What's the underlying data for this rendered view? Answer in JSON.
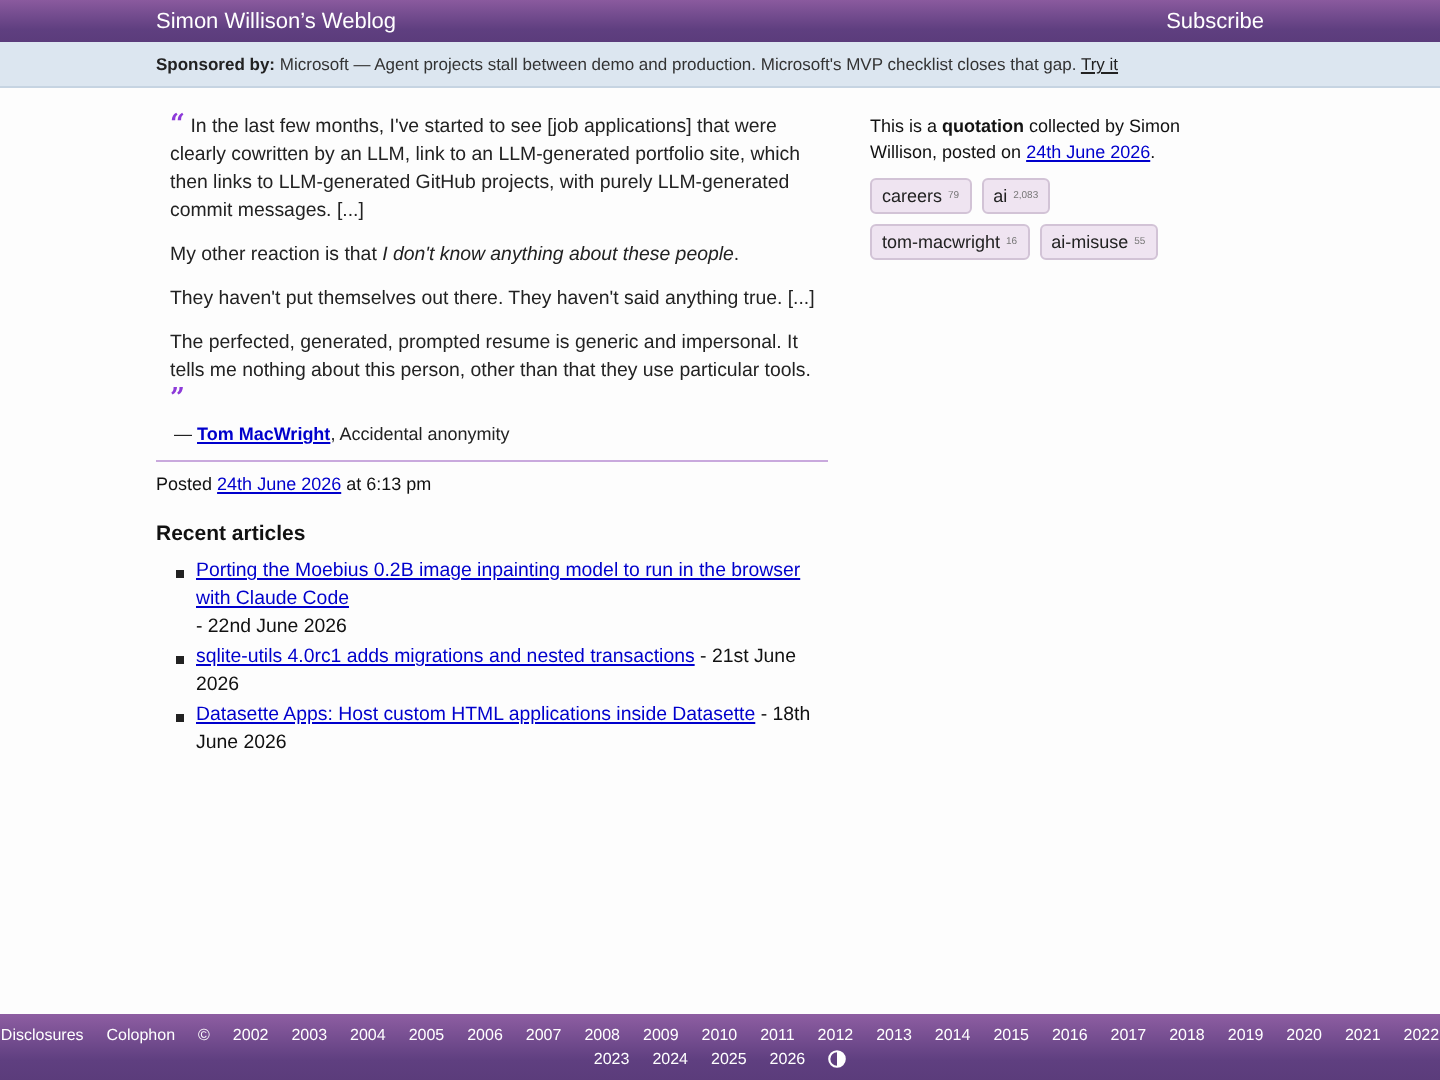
{
  "header": {
    "title": "Simon Willison’s Weblog",
    "subscribe": "Subscribe"
  },
  "sponsor": {
    "label": "Sponsored by:",
    "text": "Microsoft — Agent projects stall between demo and production. Microsoft's MVP checklist closes that gap.",
    "link": "Try it"
  },
  "quote": {
    "open_mark": "“",
    "close_mark": "”",
    "paragraphs": [
      "In the last few months, I've started to see [job applications] that were clearly cowritten by an LLM, link to an LLM-generated portfolio site, which then links to LLM-generated GitHub projects, with purely LLM-generated commit messages. [...]",
      "My other reaction is that *I don't know anything about these people*.",
      "They haven't put themselves out there. They haven't said anything true. [...]",
      "The perfected, generated, prompted resume is generic and impersonal. It tells me nothing about this person, other than that they use particular tools."
    ],
    "dash": "—",
    "author": "Tom MacWright",
    "source": ", Accidental anonymity"
  },
  "posted": {
    "prefix": "Posted",
    "date": "24th June 2026",
    "suffix": "at 6:13 pm"
  },
  "recent": {
    "heading": "Recent articles",
    "items": [
      {
        "title": "Porting the Moebius 0.2B image inpainting model to run in the browser with Claude Code",
        "date": "- 22nd June 2026"
      },
      {
        "title": "sqlite-utils 4.0rc1 adds migrations and nested transactions",
        "date": "- 21st June 2026"
      },
      {
        "title": "Datasette Apps: Host custom HTML applications inside Datasette",
        "date": "- 18th June 2026"
      }
    ]
  },
  "sidebar": {
    "intro": "This is a **quotation** collected by Simon Willison, posted on",
    "date": "24th June 2026",
    "end": ".",
    "tags": [
      {
        "name": "careers",
        "count": "79"
      },
      {
        "name": "ai",
        "count": "2,083"
      },
      {
        "name": "tom-macwright",
        "count": "16"
      },
      {
        "name": "ai-misuse",
        "count": "55"
      }
    ]
  },
  "footer": {
    "links": [
      "Disclosures",
      "Colophon",
      "©",
      "2002",
      "2003",
      "2004",
      "2005",
      "2006",
      "2007",
      "2008",
      "2009",
      "2010",
      "2011",
      "2012",
      "2013",
      "2014",
      "2015",
      "2016",
      "2017",
      "2018",
      "2019",
      "2020",
      "2021",
      "2022",
      "2023",
      "2024",
      "2025",
      "2026"
    ]
  }
}
